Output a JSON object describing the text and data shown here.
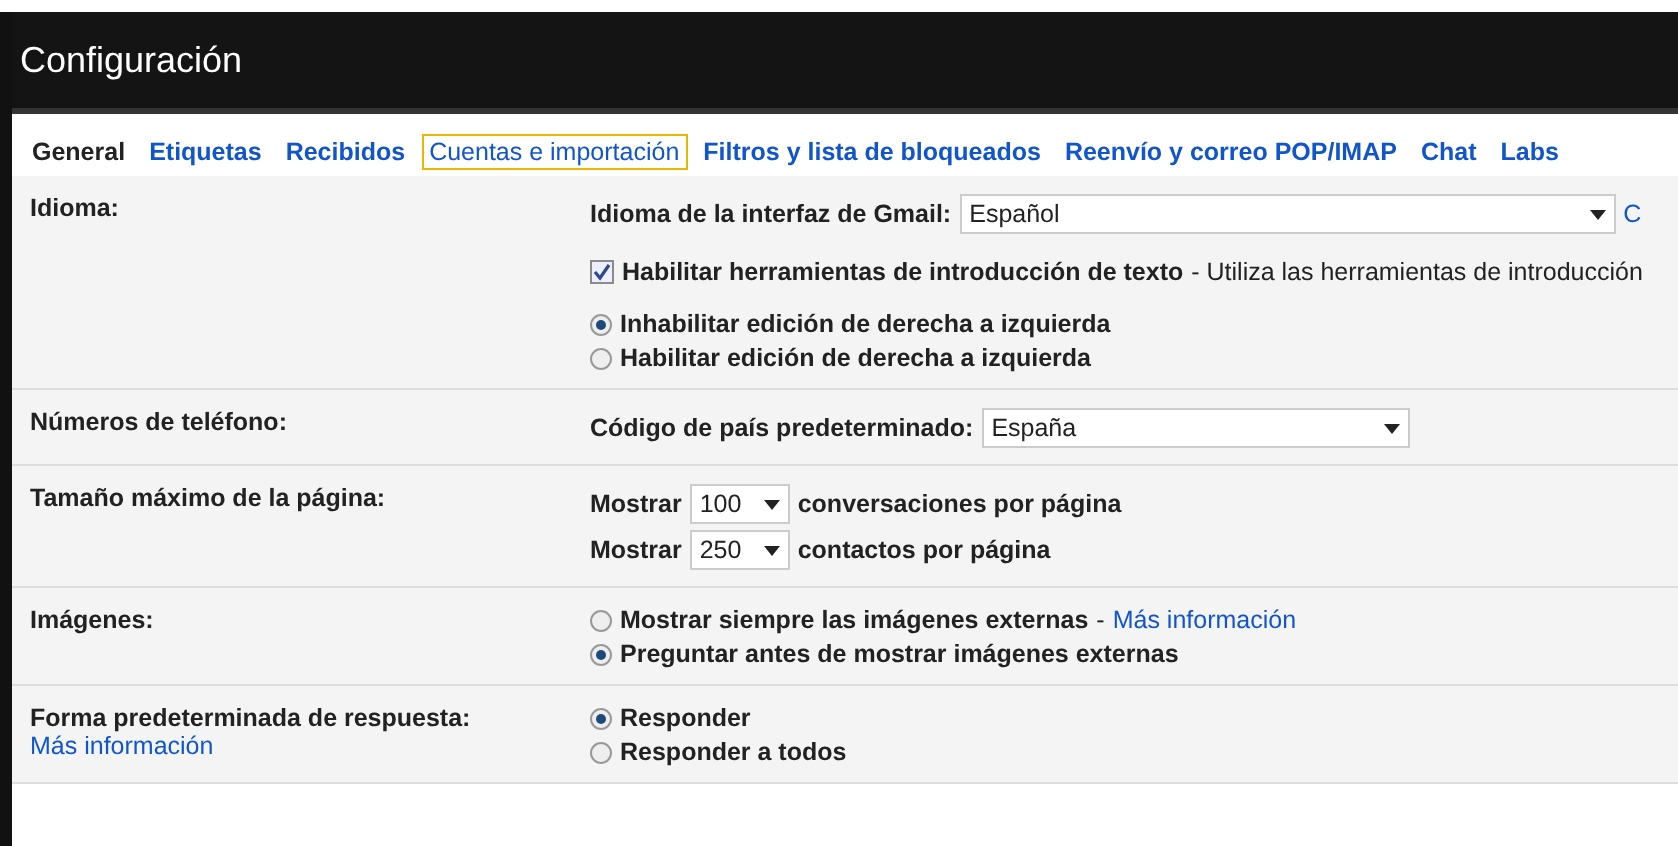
{
  "window": {
    "title": "Configuración"
  },
  "tabs": [
    {
      "label": "General",
      "selected": true
    },
    {
      "label": "Etiquetas",
      "selected": false
    },
    {
      "label": "Recibidos",
      "selected": false
    },
    {
      "label": "Cuentas e importación",
      "selected": false,
      "focused": true
    },
    {
      "label": "Filtros y lista de bloqueados",
      "selected": false
    },
    {
      "label": "Reenvío y correo POP/IMAP",
      "selected": false
    },
    {
      "label": "Chat",
      "selected": false
    },
    {
      "label": "Labs",
      "selected": false
    }
  ],
  "sections": [
    {
      "label": "Idioma:",
      "groups": [
        [
          {
            "kind": "select",
            "label": "Idioma de la interfaz de Gmail:",
            "value": "Español",
            "link": "C"
          }
        ],
        [
          {
            "kind": "checkbox",
            "label": "Habilitar herramientas de introducción de texto",
            "note": "- Utiliza las herramientas de introducción",
            "checked": true
          }
        ],
        [
          {
            "kind": "radio",
            "label": "Inhabilitar edición de derecha a izquierda",
            "selected": true
          },
          {
            "kind": "radio",
            "label": "Habilitar edición de derecha a izquierda",
            "selected": false
          }
        ]
      ]
    },
    {
      "label": "Números de teléfono:",
      "groups": [
        [
          {
            "kind": "select",
            "label": "Código de país predeterminado:",
            "value": "España"
          }
        ]
      ]
    },
    {
      "label": "Tamaño máximo de la página:",
      "groups": [
        [
          {
            "kind": "count",
            "label": "Mostrar",
            "value": "100",
            "after": "conversaciones por página"
          },
          {
            "kind": "count",
            "label": "Mostrar",
            "value": "250",
            "after": "contactos por página"
          }
        ]
      ]
    },
    {
      "label": "Imágenes:",
      "groups": [
        [
          {
            "kind": "radio",
            "label": "Mostrar siempre las imágenes externas",
            "note": "-",
            "link": "Más información",
            "selected": false
          },
          {
            "kind": "radio",
            "label": "Preguntar antes de mostrar imágenes externas",
            "selected": true
          }
        ]
      ]
    },
    {
      "label": "Forma predeterminada de respuesta:",
      "link": "Más información",
      "groups": [
        [
          {
            "kind": "radio",
            "label": "Responder",
            "selected": true
          },
          {
            "kind": "radio",
            "label": "Responder a todos",
            "selected": false
          }
        ]
      ]
    }
  ]
}
